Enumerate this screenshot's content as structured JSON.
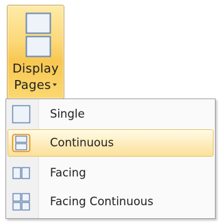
{
  "ribbon": {
    "button": {
      "label_line1": "Display",
      "label_line2": "Pages",
      "icon": "continuous-pages-icon",
      "state": "hover"
    }
  },
  "menu": {
    "items": [
      {
        "label": "Single",
        "icon": "single-page-icon",
        "selected": false
      },
      {
        "label": "Continuous",
        "icon": "continuous-page-icon",
        "selected": true
      },
      {
        "label": "Facing",
        "icon": "facing-pages-icon",
        "selected": false
      },
      {
        "label": "Facing Continuous",
        "icon": "facing-continuous-pages-icon",
        "selected": false
      }
    ]
  },
  "colors": {
    "hover_gradient_top": "#fdeba8",
    "hover_gradient_bottom": "#f8c751",
    "hover_border": "#c2a05b",
    "selected_border": "#e5c365",
    "icon_border": "#6d8bb5",
    "icon_fill": "#eef3fa",
    "menu_border": "#a0a0a0",
    "text": "#1f1f1f"
  }
}
